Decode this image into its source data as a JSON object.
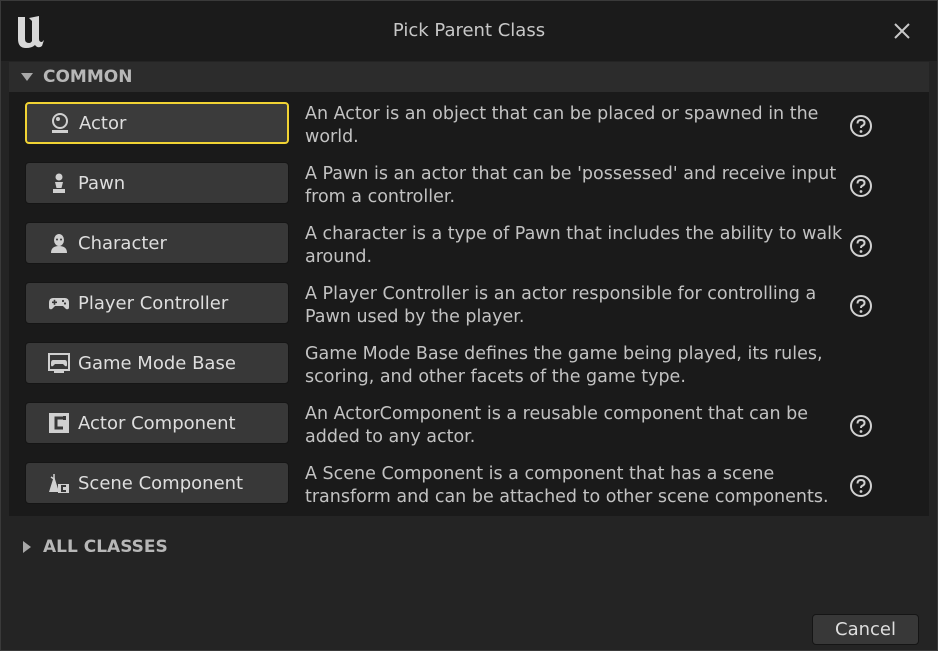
{
  "dialog": {
    "title": "Pick Parent Class"
  },
  "sections": {
    "common": "COMMON",
    "all_classes": "ALL CLASSES"
  },
  "classes": [
    {
      "label": "Actor",
      "icon": "actor-icon",
      "description": "An Actor is an object that can be placed or spawned in the world.",
      "selected": true,
      "help": true
    },
    {
      "label": "Pawn",
      "icon": "pawn-icon",
      "description": "A Pawn is an actor that can be 'possessed' and receive input from a controller.",
      "selected": false,
      "help": true
    },
    {
      "label": "Character",
      "icon": "character-icon",
      "description": "A character is a type of Pawn that includes the ability to walk around.",
      "selected": false,
      "help": true
    },
    {
      "label": "Player Controller",
      "icon": "gamepad-icon",
      "description": "A Player Controller is an actor responsible for controlling a Pawn used by the player.",
      "selected": false,
      "help": true
    },
    {
      "label": "Game Mode Base",
      "icon": "game-mode-icon",
      "description": "Game Mode Base defines the game being played, its rules, scoring, and other facets of the game type.",
      "selected": false,
      "help": false
    },
    {
      "label": "Actor Component",
      "icon": "actor-component-icon",
      "description": "An ActorComponent is a reusable component that can be added to any actor.",
      "selected": false,
      "help": true
    },
    {
      "label": "Scene Component",
      "icon": "scene-component-icon",
      "description": "A Scene Component is a component that has a scene transform and can be attached to other scene components.",
      "selected": false,
      "help": true
    }
  ],
  "footer": {
    "cancel_label": "Cancel"
  },
  "colors": {
    "selection": "#f1d334",
    "background": "#242424",
    "list_bg": "#1a1a1a"
  }
}
